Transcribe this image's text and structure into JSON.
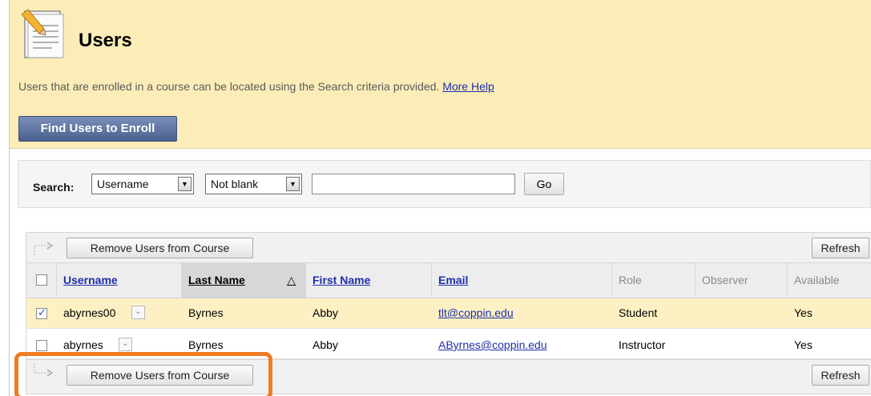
{
  "header": {
    "title": "Users",
    "description": "Users that are enrolled in a course can be located using the Search criteria provided.",
    "help_link": "More Help",
    "find_button": "Find Users to Enroll"
  },
  "search": {
    "label": "Search:",
    "field_value": "Username",
    "operator_value": "Not blank",
    "input_value": "",
    "go_button": "Go"
  },
  "actions": {
    "remove_button": "Remove Users from Course",
    "refresh_button": "Refresh"
  },
  "table": {
    "columns": [
      "Username",
      "Last Name",
      "First Name",
      "Email",
      "Role",
      "Observer",
      "Available"
    ],
    "sorted_column": "Last Name",
    "rows": [
      {
        "username": "abyrnes00",
        "last_name": "Byrnes",
        "first_name": "Abby",
        "email": "tlt@coppin.edu",
        "role": "Student",
        "observer": "",
        "available": "Yes",
        "checked": true
      },
      {
        "username": "abyrnes",
        "last_name": "Byrnes",
        "first_name": "Abby",
        "email": "AByrnes@coppin.edu",
        "role": "Instructor",
        "observer": "",
        "available": "Yes",
        "checked": false
      }
    ]
  },
  "colors": {
    "header_bg": "#fbecb8",
    "find_button_bg": "#5a6f9c",
    "selected_row_bg": "#fdf1c4",
    "link": "#1f2fa8",
    "highlight_outline": "#f07c22"
  }
}
